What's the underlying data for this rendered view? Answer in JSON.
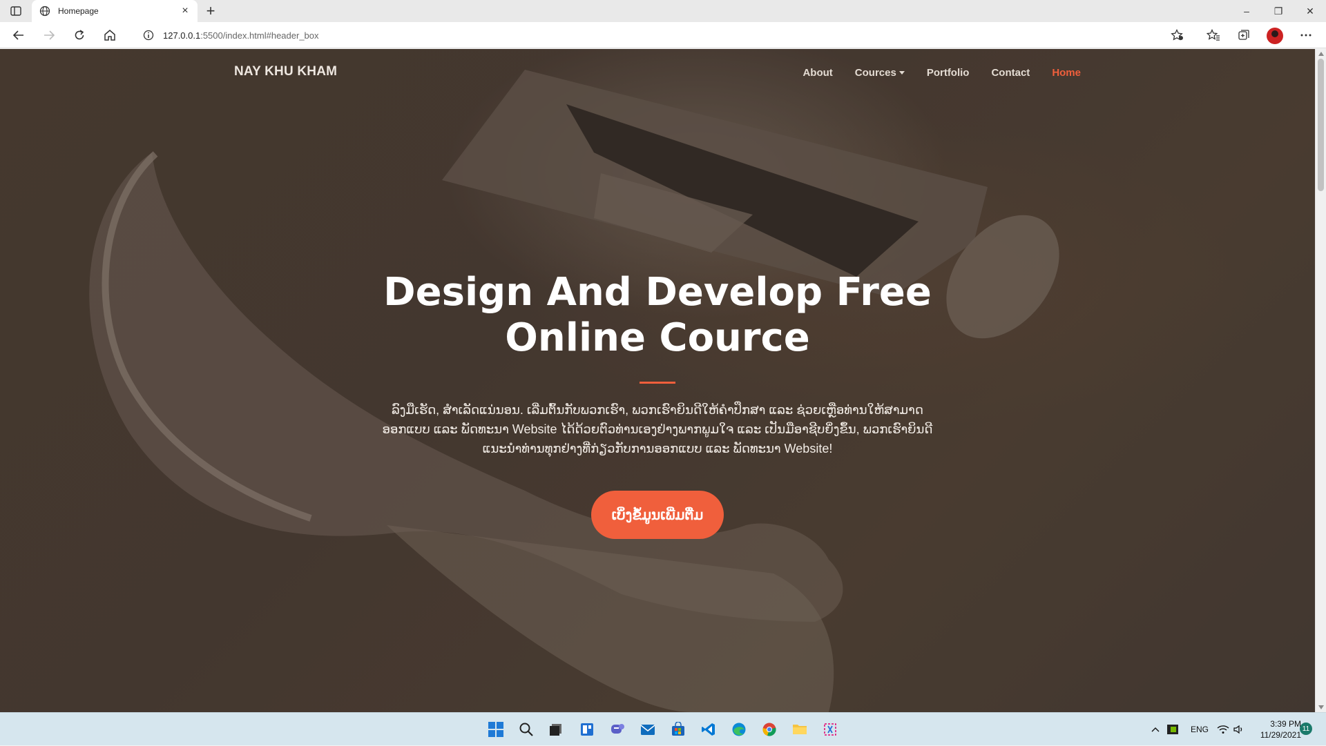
{
  "browser": {
    "tab_title": "Homepage",
    "url_host": "127.0.0.1",
    "url_path": ":5500/index.html#header_box"
  },
  "site": {
    "brand": "NAY KHU KHAM",
    "nav": [
      {
        "label": "About",
        "active": false
      },
      {
        "label": "Cources",
        "active": false,
        "dropdown": true
      },
      {
        "label": "Portfolio",
        "active": false
      },
      {
        "label": "Contact",
        "active": false
      },
      {
        "label": "Home",
        "active": true
      }
    ],
    "hero": {
      "title_line1": "Design And Develop Free",
      "title_line2": "Online Cource",
      "description": "ລົງມືເຮັດ, ສຳເລັດແນ່ນອນ. ເລີ່ມຕົ້ນກັບພວກເຮົາ, ພວກເຮົາຍິນດີໃຫ້ຄຳປຶກສາ ແລະ ຊ່ວຍເຫຼືອທ່ານໃຫ້ສາມາດອອກແບບ ແລະ ພັດທະນາ Website ໄດ້ດ້ວຍຕົວທ່ານເອງຢ່າງພາກພູມໃຈ ແລະ ເປັນມືອາຊີບຍິ່ງຂຶ້ນ, ພວກເຮົາຍິນດີແນະນຳທ່ານທຸກຢ່າງທີ່ກ່ຽວກັບການອອກແບບ ແລະ ພັດທະນາ Website!",
      "cta_label": "ເບິ່ງຂໍ້ມູນເພີ່ມຕື່ມ"
    }
  },
  "colors": {
    "accent": "#f05f3c",
    "taskbar": "#d6e6ee"
  },
  "taskbar": {
    "icons": [
      "windows-start-icon",
      "search-icon",
      "task-view-icon",
      "widgets-icon",
      "teams-chat-icon",
      "mail-icon",
      "store-icon",
      "vscode-icon",
      "edge-icon",
      "chrome-icon",
      "file-explorer-icon",
      "snipping-tool-icon"
    ],
    "tray_lang": "ENG",
    "time": "3:39 PM",
    "date": "11/29/2021",
    "notifications": "11"
  }
}
